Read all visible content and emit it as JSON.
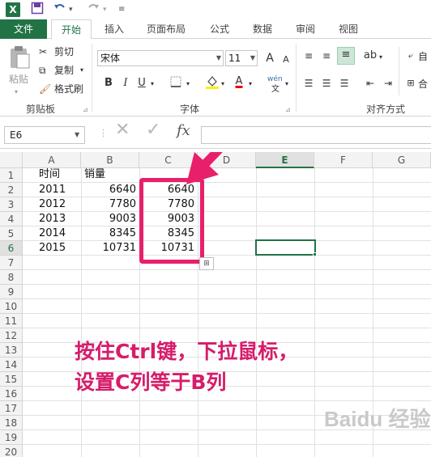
{
  "qat": {
    "app_icon": "X",
    "save_icon": "save-icon",
    "undo_icon": "undo-icon",
    "redo_icon": "redo-icon"
  },
  "tabs": [
    "文件",
    "开始",
    "插入",
    "页面布局",
    "公式",
    "数据",
    "审阅",
    "视图"
  ],
  "ribbon": {
    "clipboard": {
      "paste": "粘贴",
      "cut": "剪切",
      "copy": "复制",
      "format_painter": "格式刷",
      "label": "剪贴板"
    },
    "font": {
      "name": "宋体",
      "size": "11",
      "bold": "B",
      "italic": "I",
      "underline": "U",
      "grow": "A",
      "shrink": "A",
      "font_color": "A",
      "phonetic": "wén",
      "label": "字体"
    },
    "align": {
      "label": "对齐方式",
      "wrap_partial": "自",
      "merge_partial": "合"
    }
  },
  "formula_bar": {
    "name_box": "E6",
    "fx": "fx",
    "value": ""
  },
  "columns": [
    "A",
    "B",
    "C",
    "D",
    "E",
    "F",
    "G"
  ],
  "rows": [
    "1",
    "2",
    "3",
    "4",
    "5",
    "6",
    "7",
    "8",
    "9",
    "10",
    "11",
    "12",
    "13",
    "14",
    "15",
    "16",
    "17",
    "18",
    "19",
    "20"
  ],
  "cells": {
    "headers": {
      "A1": "时间",
      "B1": "销量"
    },
    "data": [
      {
        "year": "2011",
        "b": "6640",
        "c": "6640"
      },
      {
        "year": "2012",
        "b": "7780",
        "c": "7780"
      },
      {
        "year": "2013",
        "b": "9003",
        "c": "9003"
      },
      {
        "year": "2014",
        "b": "8345",
        "c": "8345"
      },
      {
        "year": "2015",
        "b": "10731",
        "c": "10731"
      }
    ]
  },
  "annotation": {
    "line1": "按住Ctrl键，下拉鼠标，",
    "line2": "设置C列等于B列"
  },
  "watermark": "Baidu 经验",
  "colors": {
    "accent": "#217346",
    "highlight": "#e8206b",
    "annotation": "#d61c6a"
  }
}
